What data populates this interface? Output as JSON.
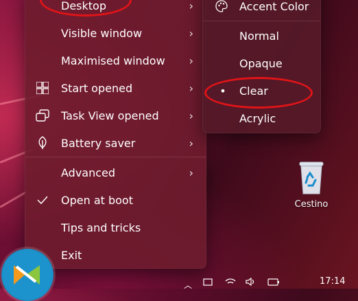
{
  "main_menu": {
    "items": [
      {
        "label": "Desktop",
        "icon": "none",
        "submenu": true
      },
      {
        "label": "Visible window",
        "icon": "none",
        "submenu": true
      },
      {
        "label": "Maximised window",
        "icon": "none",
        "submenu": true
      },
      {
        "label": "Start opened",
        "icon": "windows-logo-icon",
        "submenu": true
      },
      {
        "label": "Task View opened",
        "icon": "task-view-icon",
        "submenu": true
      },
      {
        "label": "Battery saver",
        "icon": "leaf-icon",
        "submenu": true
      },
      {
        "label": "Advanced",
        "icon": "none",
        "submenu": true
      },
      {
        "label": "Open at boot",
        "icon": "checkmark-icon",
        "submenu": false,
        "checked": true
      },
      {
        "label": "Tips and tricks",
        "icon": "none",
        "submenu": false
      },
      {
        "label": "Exit",
        "icon": "none",
        "submenu": false
      }
    ],
    "chevron": "›"
  },
  "sub_menu": {
    "header": {
      "label": "Accent Color",
      "icon": "palette-icon"
    },
    "items": [
      {
        "label": "Normal",
        "selected": false
      },
      {
        "label": "Opaque",
        "selected": false
      },
      {
        "label": "Clear",
        "selected": true
      },
      {
        "label": "Acrylic",
        "selected": false
      }
    ],
    "selected_marker": "•"
  },
  "desktop": {
    "recycle_bin_label": "Cestino"
  },
  "taskbar": {
    "time": "17:14"
  },
  "colors": {
    "annotation_ring": "#e01418",
    "menu_bg": "#6e1c2d",
    "text": "#ffffff"
  }
}
